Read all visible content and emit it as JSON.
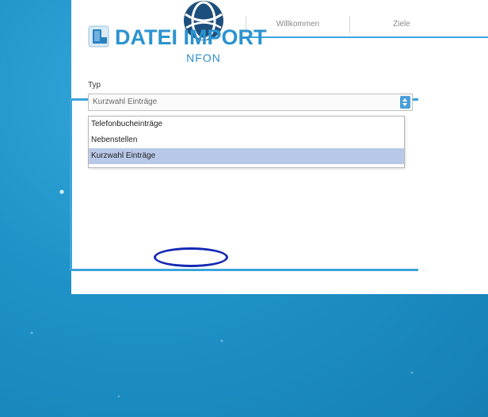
{
  "logo": {
    "text": "NFON"
  },
  "nav": {
    "items": [
      {
        "label": "Willkommen"
      },
      {
        "label": "Ziele"
      }
    ]
  },
  "card": {
    "icon": "import-icon",
    "title": "DATEI IMPORT",
    "field_label": "Typ",
    "select": {
      "value": "Kurzwahl Einträge",
      "options": [
        {
          "label": "Telefonbucheinträge"
        },
        {
          "label": "Nebenstellen"
        },
        {
          "label": "Kurzwahl Einträge",
          "selected": true
        }
      ]
    }
  },
  "colors": {
    "accent": "#2c93cf",
    "background": "#1d8fc4",
    "annotation": "#1428b4"
  }
}
